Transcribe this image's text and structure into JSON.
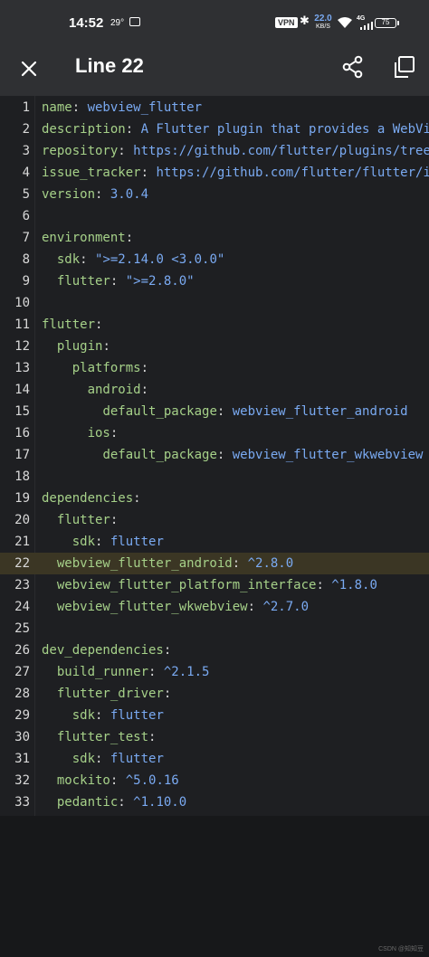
{
  "status_bar": {
    "time": "14:52",
    "temperature": "29°",
    "vpn": "VPN",
    "net_speed": "22.0",
    "net_unit": "KB/S",
    "network": "4G",
    "battery": "75"
  },
  "app_bar": {
    "title": "Line 22",
    "close_icon": "close-icon",
    "share_icon": "share-icon",
    "copy_icon": "copy-icon"
  },
  "editor": {
    "highlighted_line": 22,
    "lines": [
      {
        "n": "1",
        "indent": "",
        "key": "name",
        "sep": ": ",
        "val": "webview_flutter"
      },
      {
        "n": "2",
        "indent": "",
        "key": "description",
        "sep": ": ",
        "val": "A Flutter plugin that provides a WebView"
      },
      {
        "n": "3",
        "indent": "",
        "key": "repository",
        "sep": ": ",
        "val": "https://github.com/flutter/plugins/tree/main"
      },
      {
        "n": "4",
        "indent": "",
        "key": "issue_tracker",
        "sep": ": ",
        "val": "https://github.com/flutter/flutter/issues"
      },
      {
        "n": "5",
        "indent": "",
        "key": "version",
        "sep": ": ",
        "val": "3.0.4"
      },
      {
        "n": "6",
        "indent": "",
        "key": "",
        "sep": "",
        "val": ""
      },
      {
        "n": "7",
        "indent": "",
        "key": "environment",
        "sep": ":",
        "val": ""
      },
      {
        "n": "8",
        "indent": "  ",
        "key": "sdk",
        "sep": ": ",
        "val": "\">=2.14.0 <3.0.0\""
      },
      {
        "n": "9",
        "indent": "  ",
        "key": "flutter",
        "sep": ": ",
        "val": "\">=2.8.0\""
      },
      {
        "n": "10",
        "indent": "",
        "key": "",
        "sep": "",
        "val": ""
      },
      {
        "n": "11",
        "indent": "",
        "key": "flutter",
        "sep": ":",
        "val": ""
      },
      {
        "n": "12",
        "indent": "  ",
        "key": "plugin",
        "sep": ":",
        "val": ""
      },
      {
        "n": "13",
        "indent": "    ",
        "key": "platforms",
        "sep": ":",
        "val": ""
      },
      {
        "n": "14",
        "indent": "      ",
        "key": "android",
        "sep": ":",
        "val": ""
      },
      {
        "n": "15",
        "indent": "        ",
        "key": "default_package",
        "sep": ": ",
        "val": "webview_flutter_android"
      },
      {
        "n": "16",
        "indent": "      ",
        "key": "ios",
        "sep": ":",
        "val": ""
      },
      {
        "n": "17",
        "indent": "        ",
        "key": "default_package",
        "sep": ": ",
        "val": "webview_flutter_wkwebview"
      },
      {
        "n": "18",
        "indent": "",
        "key": "",
        "sep": "",
        "val": ""
      },
      {
        "n": "19",
        "indent": "",
        "key": "dependencies",
        "sep": ":",
        "val": ""
      },
      {
        "n": "20",
        "indent": "  ",
        "key": "flutter",
        "sep": ":",
        "val": ""
      },
      {
        "n": "21",
        "indent": "    ",
        "key": "sdk",
        "sep": ": ",
        "val": "flutter"
      },
      {
        "n": "22",
        "indent": "  ",
        "key": "webview_flutter_android",
        "sep": ": ",
        "val": "^2.8.0"
      },
      {
        "n": "23",
        "indent": "  ",
        "key": "webview_flutter_platform_interface",
        "sep": ": ",
        "val": "^1.8.0"
      },
      {
        "n": "24",
        "indent": "  ",
        "key": "webview_flutter_wkwebview",
        "sep": ": ",
        "val": "^2.7.0"
      },
      {
        "n": "25",
        "indent": "",
        "key": "",
        "sep": "",
        "val": ""
      },
      {
        "n": "26",
        "indent": "",
        "key": "dev_dependencies",
        "sep": ":",
        "val": ""
      },
      {
        "n": "27",
        "indent": "  ",
        "key": "build_runner",
        "sep": ": ",
        "val": "^2.1.5"
      },
      {
        "n": "28",
        "indent": "  ",
        "key": "flutter_driver",
        "sep": ":",
        "val": ""
      },
      {
        "n": "29",
        "indent": "    ",
        "key": "sdk",
        "sep": ": ",
        "val": "flutter"
      },
      {
        "n": "30",
        "indent": "  ",
        "key": "flutter_test",
        "sep": ":",
        "val": ""
      },
      {
        "n": "31",
        "indent": "    ",
        "key": "sdk",
        "sep": ": ",
        "val": "flutter"
      },
      {
        "n": "32",
        "indent": "  ",
        "key": "mockito",
        "sep": ": ",
        "val": "^5.0.16"
      },
      {
        "n": "33",
        "indent": "  ",
        "key": "pedantic",
        "sep": ": ",
        "val": "^1.10.0"
      }
    ]
  },
  "watermark": "CSDN @知知豆",
  "colors": {
    "key": "#a6d189",
    "value": "#7aaaf2",
    "highlight": "#3b3624",
    "app_bar": "#2f3033",
    "editor_bg": "#1e1f22"
  }
}
